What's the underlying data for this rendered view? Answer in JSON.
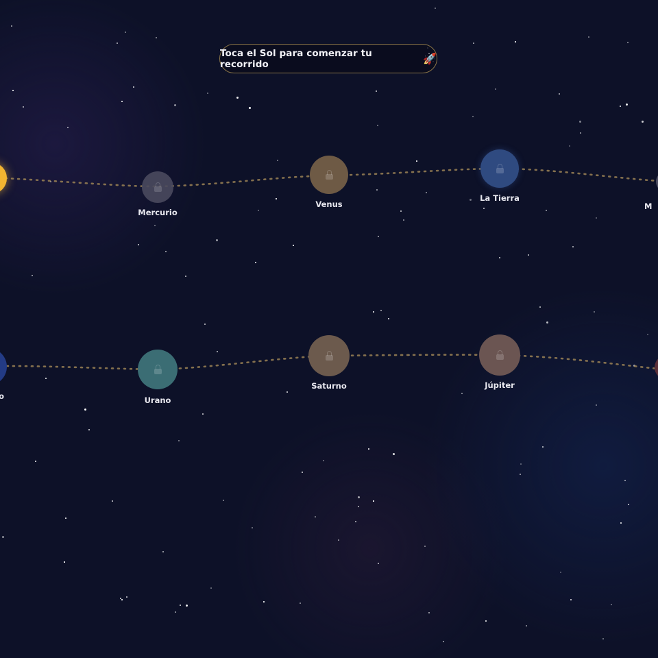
{
  "banner": {
    "text": "Toca el Sol para comenzar tu recorrido",
    "icon": "🚀"
  },
  "planets": [
    {
      "name": "Sol",
      "icon": "sun",
      "locked": false,
      "color": "#f3b531"
    },
    {
      "name": "Mercurio",
      "icon": "lock-icon",
      "locked": true,
      "color": "#4a4a5e"
    },
    {
      "name": "Venus",
      "icon": "lock-icon",
      "locked": true,
      "color": "#6e5a45"
    },
    {
      "name": "La Tierra",
      "icon": "lock-icon",
      "locked": true,
      "color": "#2f4a80"
    },
    {
      "name": "M",
      "icon": "lock-icon",
      "locked": true,
      "color": "#4c4c60"
    },
    {
      "name": "Júpiter",
      "icon": "lock-icon",
      "locked": true,
      "color": "#6b5552"
    },
    {
      "name": "Saturno",
      "icon": "lock-icon",
      "locked": true,
      "color": "#6c5a4d"
    },
    {
      "name": "Urano",
      "icon": "lock-icon",
      "locked": true,
      "color": "#3b6d74"
    },
    {
      "name": "o",
      "icon": "lock-icon",
      "locked": true,
      "color": "#233b85"
    }
  ],
  "colors": {
    "background": "#0d1128",
    "path": "#9b8255",
    "banner_border": "#8a7548"
  }
}
